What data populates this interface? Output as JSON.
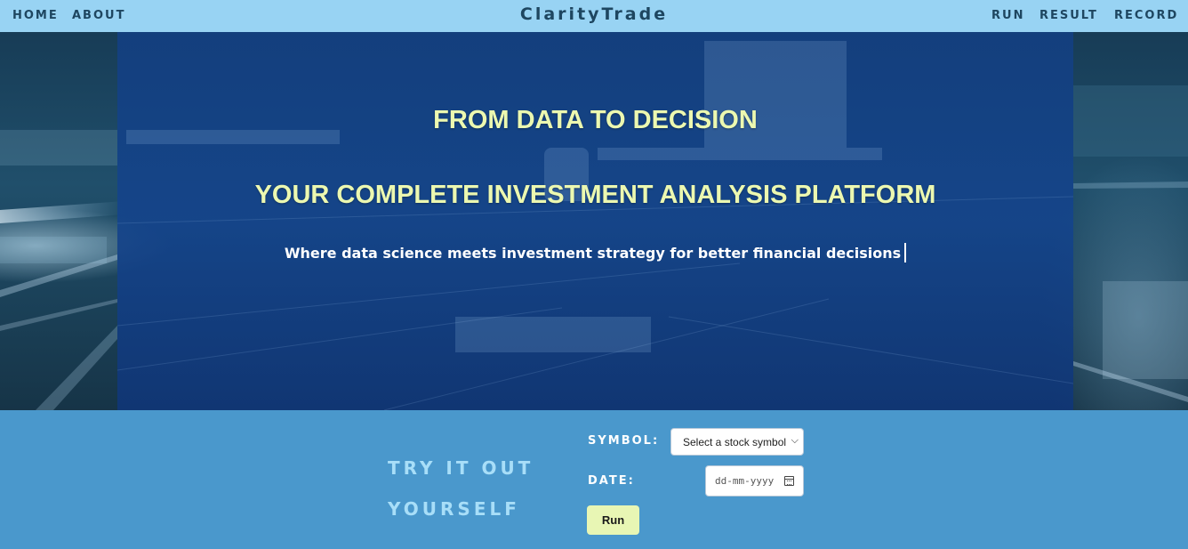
{
  "nav": {
    "home": "HOME",
    "about": "ABOUT",
    "brand": "ClarityTrade",
    "run": "RUN",
    "result": "RESULT",
    "record": "RECORD"
  },
  "hero": {
    "heading1": "FROM DATA TO DECISION",
    "heading2": "YOUR COMPLETE INVESTMENT ANALYSIS PLATFORM",
    "subtitle": "Where data science meets investment strategy for better financial decisions"
  },
  "try": {
    "title_line1": "TRY IT OUT",
    "title_line2": "YOURSELF",
    "symbol_label": "SYMBOL:",
    "symbol_value": "Select a stock symbol",
    "date_label": "DATE:",
    "date_placeholder": "dd-mm-yyyy",
    "run_label": "Run"
  },
  "colors": {
    "nav_bg": "#98d3f3",
    "hero_overlay": "#14448c",
    "heading_text": "#ecf8b0",
    "section_bg": "#4a98cc",
    "button_bg": "#e8f6b4"
  }
}
